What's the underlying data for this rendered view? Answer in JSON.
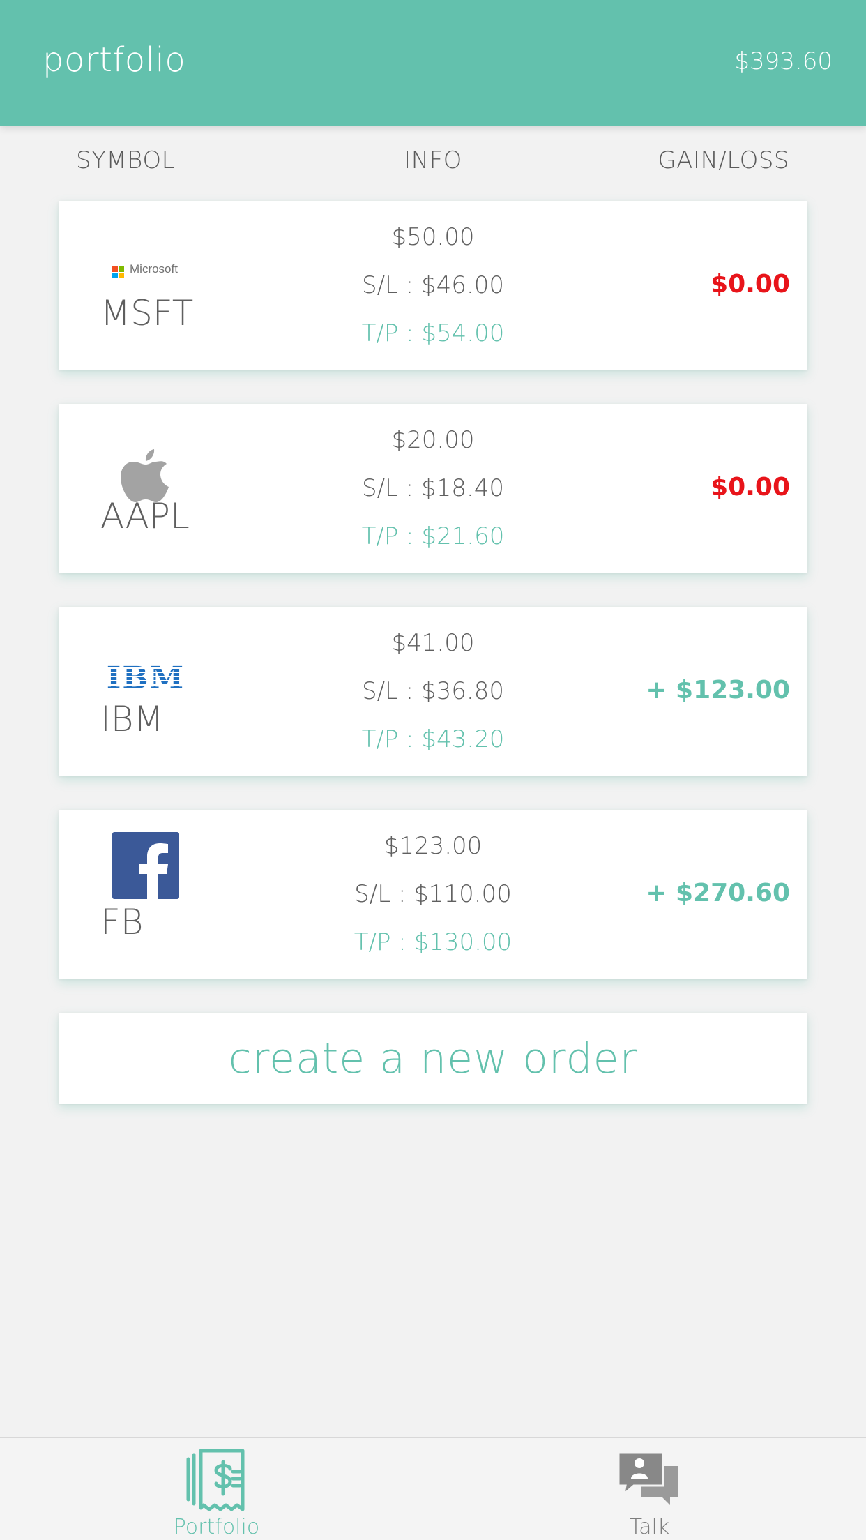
{
  "header": {
    "title": "portfolio",
    "total": "$393.60"
  },
  "columns": {
    "symbol": "SYMBOL",
    "info": "INFO",
    "gain": "GAIN/LOSS"
  },
  "colors": {
    "accent": "#63c1ad",
    "loss": "#e8141a",
    "text": "#5f5f5f"
  },
  "positions": [
    {
      "ticker": "MSFT",
      "logo": "microsoft-logo",
      "logo_text": "Microsoft",
      "price": "$50.00",
      "sl": "S/L : $46.00",
      "tp": "T/P : $54.00",
      "gain": "$0.00",
      "gain_state": "loss"
    },
    {
      "ticker": "AAPL",
      "logo": "apple-logo",
      "price": "$20.00",
      "sl": "S/L : $18.40",
      "tp": "T/P : $21.60",
      "gain": "$0.00",
      "gain_state": "loss"
    },
    {
      "ticker": "IBM",
      "logo": "ibm-logo",
      "logo_text": "IBM",
      "price": "$41.00",
      "sl": "S/L : $36.80",
      "tp": "T/P : $43.20",
      "gain": "+ $123.00",
      "gain_state": "gain"
    },
    {
      "ticker": "FB",
      "logo": "facebook-logo",
      "price": "$123.00",
      "sl": "S/L : $110.00",
      "tp": "T/P : $130.00",
      "gain": "+ $270.60",
      "gain_state": "gain"
    }
  ],
  "create_order": "create a new order",
  "tabs": [
    {
      "label": "Portfolio",
      "icon": "receipt-dollar-icon",
      "active": true
    },
    {
      "label": "Talk",
      "icon": "chat-bubbles-icon",
      "active": false
    }
  ]
}
